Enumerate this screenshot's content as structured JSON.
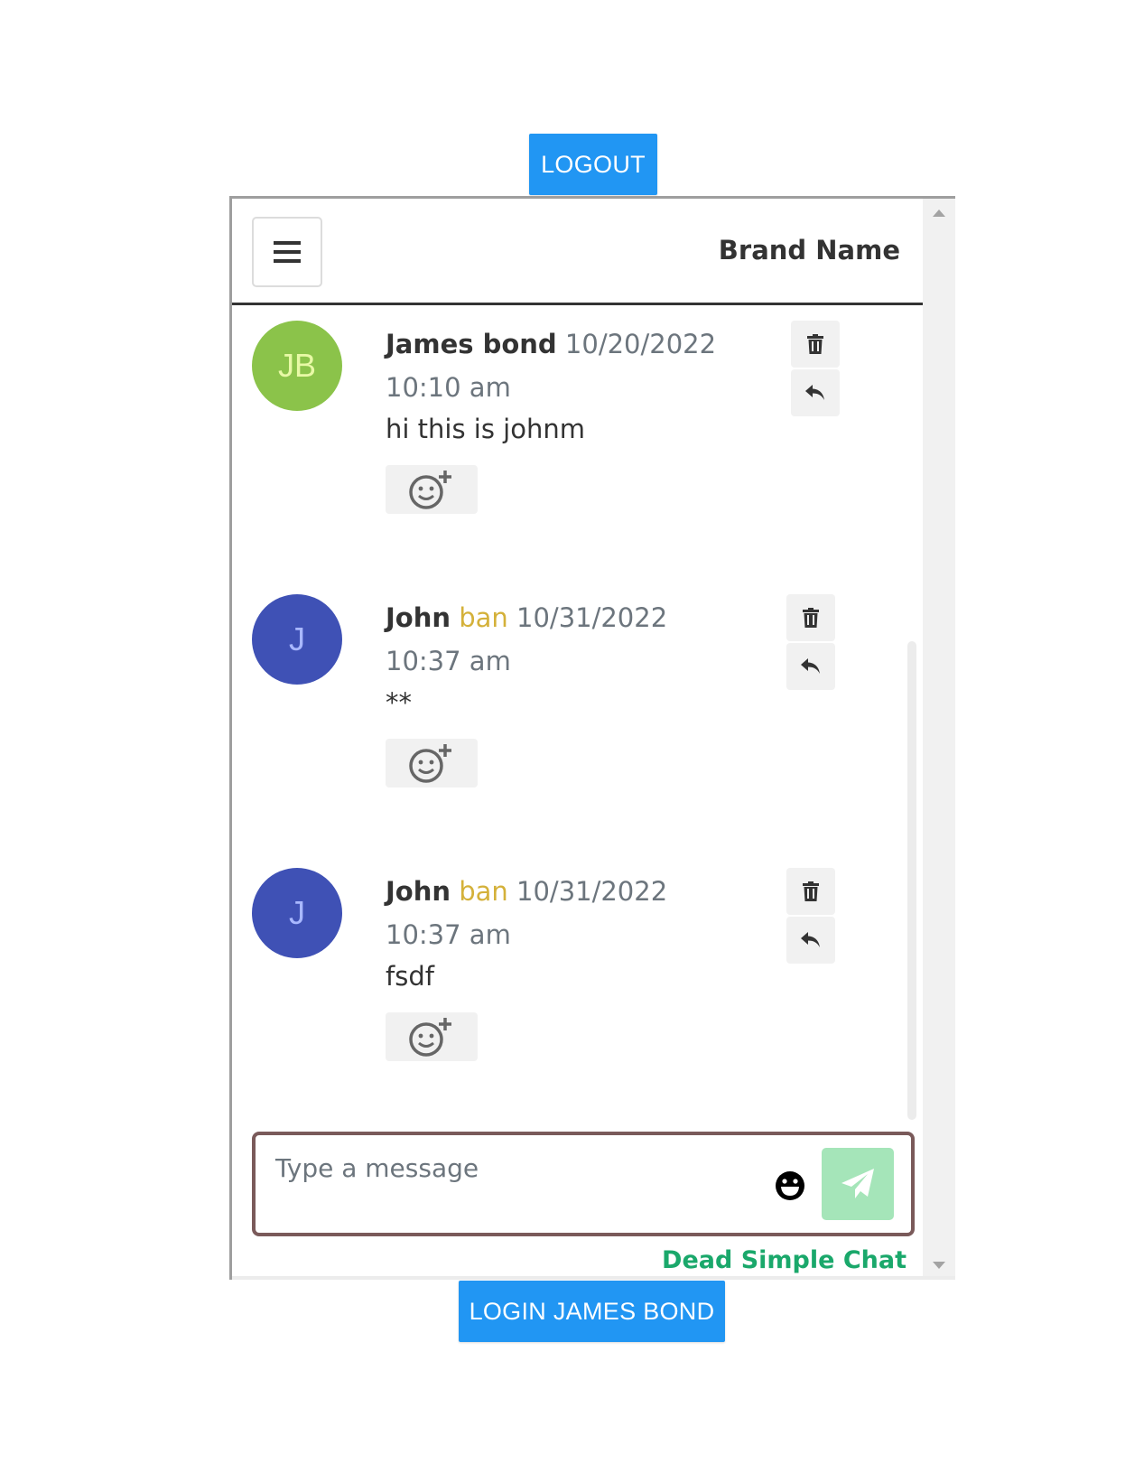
{
  "buttons": {
    "logout": "LOGOUT",
    "login": "LOGIN JAMES BOND"
  },
  "header": {
    "brand": "Brand Name",
    "menu_icon": "hamburger-icon"
  },
  "messages": [
    {
      "initials": "JB",
      "name": "James bond",
      "badge": "",
      "timestamp": "10/20/2022 10:10 am",
      "text": "hi this is johnm"
    },
    {
      "initials": "J",
      "name": "John",
      "badge": "ban",
      "timestamp": "10/31/2022 10:37 am",
      "text": "**"
    },
    {
      "initials": "J",
      "name": "John",
      "badge": "ban",
      "timestamp": "10/31/2022 10:37 am",
      "text": "fsdf"
    }
  ],
  "composer": {
    "placeholder": "Type a message",
    "value": ""
  },
  "footer": {
    "powered_by": "Dead Simple Chat"
  },
  "colors": {
    "primary_button": "#2196f3",
    "avatar_jb": "#8bc34a",
    "avatar_j": "#3f51b5",
    "ban_text": "#d4b13a",
    "send_button": "#a5e5b9",
    "composer_border": "#7a5a5a",
    "brand_green": "#1aa86b"
  },
  "icons": [
    "hamburger-icon",
    "trash-icon",
    "reply-icon",
    "add-reaction-icon",
    "emoji-icon",
    "send-icon"
  ]
}
